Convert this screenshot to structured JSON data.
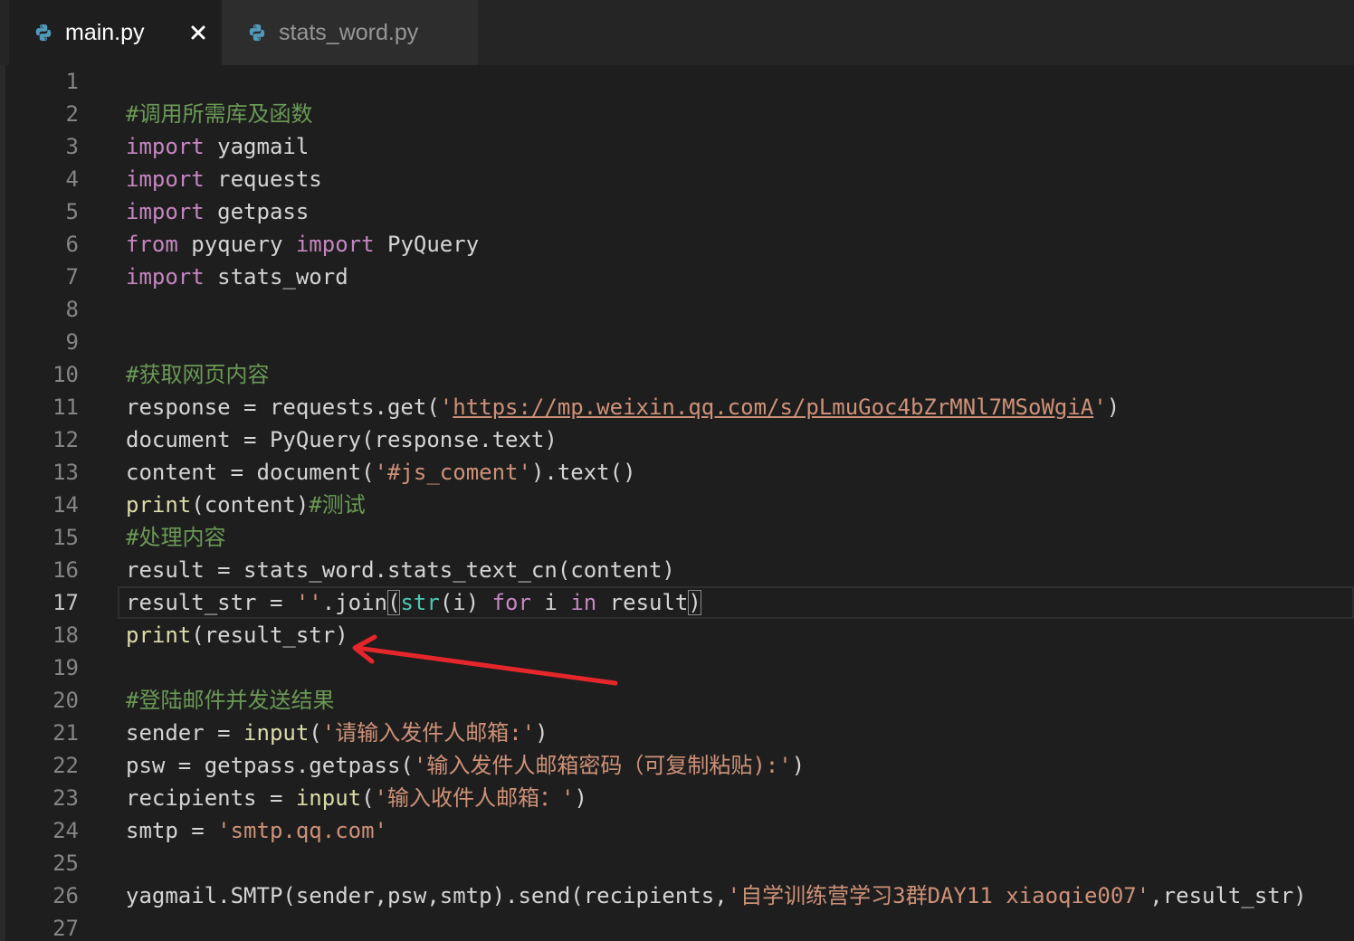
{
  "tabs": [
    {
      "label": "main.py",
      "icon": "python-file-icon",
      "close_icon": "close-icon"
    },
    {
      "label": "stats_word.py",
      "icon": "python-file-icon"
    }
  ],
  "editor": {
    "active_line": 17,
    "lines": [
      {
        "number": 1,
        "tokens": []
      },
      {
        "number": 2,
        "tokens": [
          {
            "t": "comment",
            "text": "#调用所需库及函数"
          }
        ]
      },
      {
        "number": 3,
        "tokens": [
          {
            "t": "keyword",
            "text": "import"
          },
          {
            "t": "plain",
            "text": " yagmail"
          }
        ]
      },
      {
        "number": 4,
        "tokens": [
          {
            "t": "keyword",
            "text": "import"
          },
          {
            "t": "plain",
            "text": " requests"
          }
        ]
      },
      {
        "number": 5,
        "tokens": [
          {
            "t": "keyword",
            "text": "import"
          },
          {
            "t": "plain",
            "text": " getpass"
          }
        ]
      },
      {
        "number": 6,
        "tokens": [
          {
            "t": "keyword",
            "text": "from"
          },
          {
            "t": "plain",
            "text": " pyquery "
          },
          {
            "t": "keyword",
            "text": "import"
          },
          {
            "t": "plain",
            "text": " PyQuery"
          }
        ]
      },
      {
        "number": 7,
        "tokens": [
          {
            "t": "keyword",
            "text": "import"
          },
          {
            "t": "plain",
            "text": " stats_word"
          }
        ]
      },
      {
        "number": 8,
        "tokens": []
      },
      {
        "number": 9,
        "tokens": []
      },
      {
        "number": 10,
        "tokens": [
          {
            "t": "comment",
            "text": "#获取网页内容"
          }
        ]
      },
      {
        "number": 11,
        "tokens": [
          {
            "t": "plain",
            "text": "response = requests.get("
          },
          {
            "t": "string",
            "text": "'"
          },
          {
            "t": "url",
            "text": "https://mp.weixin.qq.com/s/pLmuGoc4bZrMNl7MSoWgiA"
          },
          {
            "t": "string",
            "text": "'"
          },
          {
            "t": "plain",
            "text": ")"
          }
        ]
      },
      {
        "number": 12,
        "tokens": [
          {
            "t": "plain",
            "text": "document = PyQuery(response.text)"
          }
        ]
      },
      {
        "number": 13,
        "tokens": [
          {
            "t": "plain",
            "text": "content = document("
          },
          {
            "t": "string",
            "text": "'#js_coment'"
          },
          {
            "t": "plain",
            "text": ").text()"
          }
        ]
      },
      {
        "number": 14,
        "tokens": [
          {
            "t": "function",
            "text": "print"
          },
          {
            "t": "plain",
            "text": "(content)"
          },
          {
            "t": "comment",
            "text": "#测试"
          }
        ]
      },
      {
        "number": 15,
        "tokens": [
          {
            "t": "comment",
            "text": "#处理内容"
          }
        ]
      },
      {
        "number": 16,
        "tokens": [
          {
            "t": "plain",
            "text": "result = stats_word.stats_text_cn(content)"
          }
        ]
      },
      {
        "number": 17,
        "tokens": [
          {
            "t": "plain",
            "text": "result_str = "
          },
          {
            "t": "string",
            "text": "''"
          },
          {
            "t": "plain",
            "text": ".join"
          },
          {
            "t": "bracket",
            "text": "("
          },
          {
            "t": "type",
            "text": "str"
          },
          {
            "t": "plain",
            "text": "(i) "
          },
          {
            "t": "keyword",
            "text": "for"
          },
          {
            "t": "plain",
            "text": " i "
          },
          {
            "t": "keyword",
            "text": "in"
          },
          {
            "t": "plain",
            "text": " result"
          },
          {
            "t": "bracket",
            "text": ")"
          }
        ]
      },
      {
        "number": 18,
        "tokens": [
          {
            "t": "function",
            "text": "print"
          },
          {
            "t": "plain",
            "text": "(result_str)"
          }
        ]
      },
      {
        "number": 19,
        "tokens": []
      },
      {
        "number": 20,
        "tokens": [
          {
            "t": "comment",
            "text": "#登陆邮件并发送结果"
          }
        ]
      },
      {
        "number": 21,
        "tokens": [
          {
            "t": "plain",
            "text": "sender = "
          },
          {
            "t": "function",
            "text": "input"
          },
          {
            "t": "plain",
            "text": "("
          },
          {
            "t": "string",
            "text": "'请输入发件人邮箱:'"
          },
          {
            "t": "plain",
            "text": ")"
          }
        ]
      },
      {
        "number": 22,
        "tokens": [
          {
            "t": "plain",
            "text": "psw = getpass.getpass("
          },
          {
            "t": "string",
            "text": "'输入发件人邮箱密码（可复制粘贴):'"
          },
          {
            "t": "plain",
            "text": ")"
          }
        ]
      },
      {
        "number": 23,
        "tokens": [
          {
            "t": "plain",
            "text": "recipients = "
          },
          {
            "t": "function",
            "text": "input"
          },
          {
            "t": "plain",
            "text": "("
          },
          {
            "t": "string",
            "text": "'输入收件人邮箱：'"
          },
          {
            "t": "plain",
            "text": ")"
          }
        ]
      },
      {
        "number": 24,
        "tokens": [
          {
            "t": "plain",
            "text": "smtp = "
          },
          {
            "t": "string",
            "text": "'smtp.qq.com'"
          }
        ]
      },
      {
        "number": 25,
        "tokens": []
      },
      {
        "number": 26,
        "tokens": [
          {
            "t": "plain",
            "text": "yagmail.SMTP(sender,psw,smtp).send(recipients,"
          },
          {
            "t": "string",
            "text": "'自学训练营学习3群DAY11 xiaoqie007'"
          },
          {
            "t": "plain",
            "text": ",result_str)"
          }
        ]
      },
      {
        "number": 27,
        "tokens": []
      }
    ]
  },
  "annotation": {
    "icon": "red-arrow-icon",
    "color": "#e5262b"
  },
  "theme": {
    "background": "#1e1e1e",
    "tab_bar": "#252526",
    "tab_active": "#1e1e1e",
    "tab_inactive": "#2d2d2d",
    "text": "#d4d4d4",
    "line_number": "#858585",
    "line_number_active": "#c6c6c6",
    "keyword": "#c586c0",
    "string": "#ce9178",
    "comment": "#6a9955",
    "function": "#dcdcaa",
    "type": "#4ec9b0",
    "icon": "#519aba"
  }
}
